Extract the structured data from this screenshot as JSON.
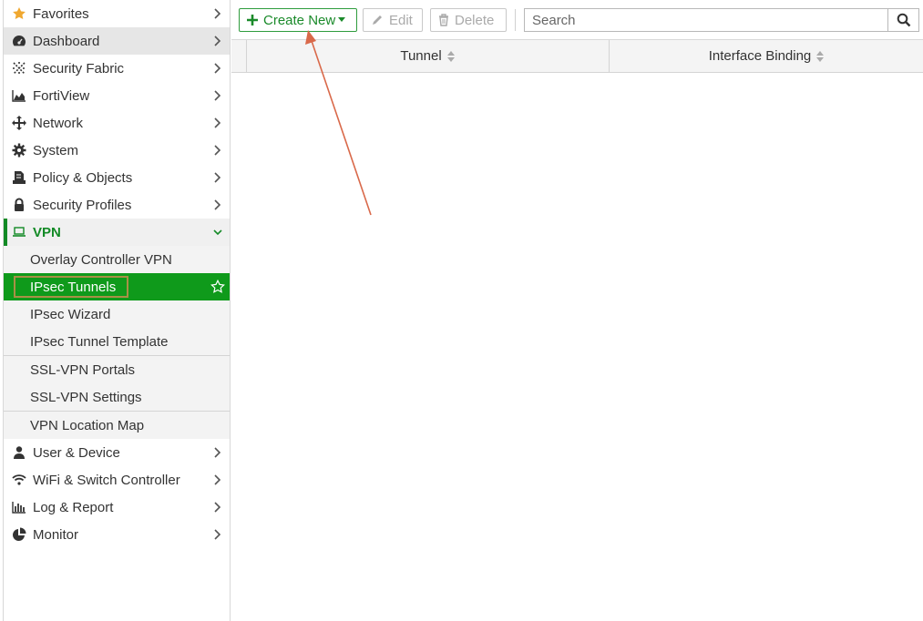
{
  "sidebar": {
    "items": [
      {
        "label": "Favorites",
        "icon": "star-icon"
      },
      {
        "label": "Dashboard",
        "icon": "dashboard-icon"
      },
      {
        "label": "Security Fabric",
        "icon": "security-fabric-icon"
      },
      {
        "label": "FortiView",
        "icon": "area-chart-icon"
      },
      {
        "label": "Network",
        "icon": "network-arrows-icon"
      },
      {
        "label": "System",
        "icon": "gear-icon"
      },
      {
        "label": "Policy & Objects",
        "icon": "policy-icon"
      },
      {
        "label": "Security Profiles",
        "icon": "lock-icon"
      },
      {
        "label": "VPN",
        "icon": "laptop-icon"
      }
    ],
    "vpn_subitems": [
      {
        "label": "Overlay Controller VPN"
      },
      {
        "label": "IPsec Tunnels"
      },
      {
        "label": "IPsec Wizard"
      },
      {
        "label": "IPsec Tunnel Template"
      },
      {
        "label": "SSL-VPN Portals"
      },
      {
        "label": "SSL-VPN Settings"
      },
      {
        "label": "VPN Location Map"
      }
    ],
    "bottom_items": [
      {
        "label": "User & Device",
        "icon": "user-icon"
      },
      {
        "label": "WiFi & Switch Controller",
        "icon": "wifi-icon"
      },
      {
        "label": "Log & Report",
        "icon": "bar-chart-icon"
      },
      {
        "label": "Monitor",
        "icon": "pie-chart-icon"
      }
    ]
  },
  "toolbar": {
    "create_label": "Create New",
    "edit_label": "Edit",
    "delete_label": "Delete",
    "search_placeholder": "Search"
  },
  "table": {
    "columns": [
      "Tunnel",
      "Interface Binding"
    ]
  },
  "colors": {
    "accent_green": "#0f9a1b",
    "annotation_arrow": "#d9694a"
  }
}
